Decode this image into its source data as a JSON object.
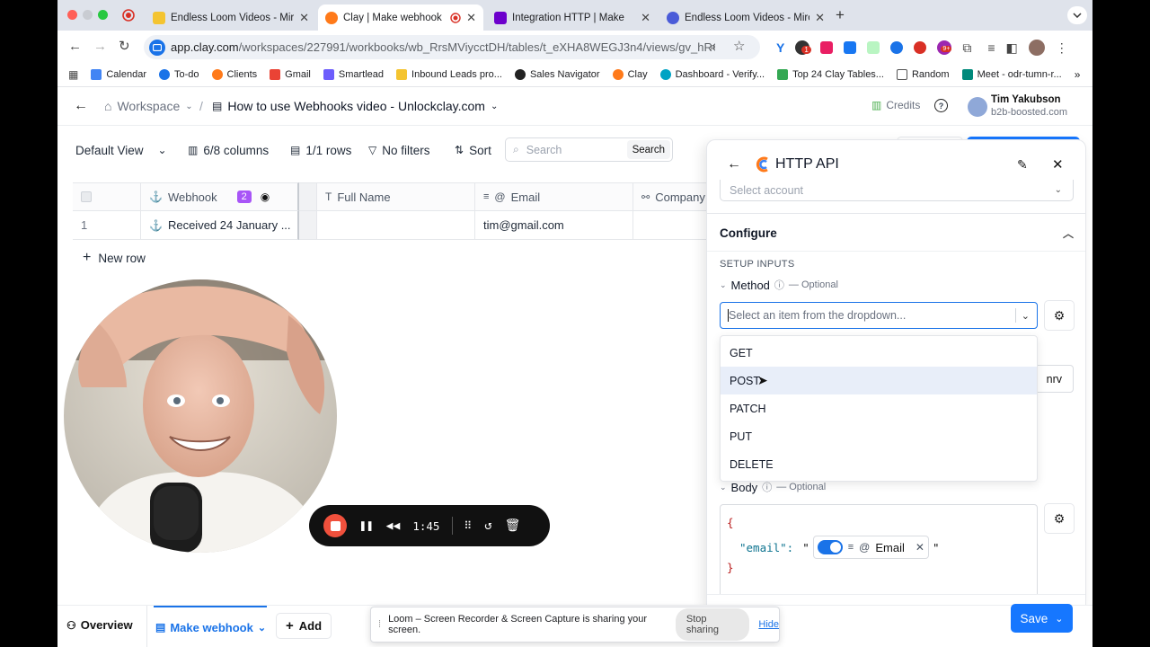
{
  "browser": {
    "tabs": [
      {
        "title": "Endless Loom Videos - Miro",
        "color": "#f4c430"
      },
      {
        "title": "Clay | Make webhook",
        "color": "#ff7a1a"
      },
      {
        "title": "Integration HTTP | Make",
        "color": "#6d00cc"
      },
      {
        "title": "Endless Loom Videos - Miro",
        "color": "#4a5bd8"
      }
    ],
    "url_host": "app.clay.com",
    "url_path": "/workspaces/227991/workbooks/wb_RrsMViycctDH/tables/t_eXHA8WEGJ3n4/views/gv_hRGJBeg...",
    "bookmarks": [
      "Calendar",
      "To-do",
      "Clients",
      "Gmail",
      "Smartlead",
      "Inbound Leads pro...",
      "Sales Navigator",
      "Clay",
      "Dashboard - Verify...",
      "Top 24 Clay Tables...",
      "Random",
      "Meet - odr-tumn-r..."
    ],
    "extension_badge": "1",
    "extension_badge2": "9+"
  },
  "app": {
    "breadcrumb_workspace": "Workspace",
    "breadcrumb_separator": "/",
    "workbook_title": "How to use Webhooks video - Unlockclay.com",
    "credits_label": "Credits",
    "user_name": "Tim Yakubson",
    "user_org": "b2b-boosted.com"
  },
  "toolbar": {
    "view": "Default View",
    "columns": "6/8 columns",
    "rows": "1/1 rows",
    "filters": "No filters",
    "sort": "Sort",
    "search_placeholder": "Search",
    "search_button": "Search"
  },
  "table": {
    "headers": [
      "Webhook",
      "Full Name",
      "Email",
      "Company"
    ],
    "webhook_badge": "2",
    "rows": [
      {
        "index": "1",
        "webhook": "Received 24 January ...",
        "full_name": "",
        "email": "tim@gmail.com",
        "company": ""
      }
    ],
    "new_row": "New row"
  },
  "recorder": {
    "time": "1:45"
  },
  "panel": {
    "title": "HTTP API",
    "select_account": "Select account",
    "configure": "Configure",
    "setup_inputs": "SETUP INPUTS",
    "method_label": "Method",
    "optional": "— Optional",
    "method_placeholder": "Select an item from the dropdown...",
    "method_options": [
      "GET",
      "POST",
      "PATCH",
      "PUT",
      "DELETE"
    ],
    "highlighted_option": "POST",
    "hidden_field_tail": "nrv",
    "body_label": "Body",
    "body_open": "{",
    "body_key": "\"email\":",
    "body_quote_open": "\"",
    "body_token": "Email",
    "body_quote_close": "\"",
    "body_close": "}",
    "save": "Save"
  },
  "bottom": {
    "overview": "Overview",
    "active_tab": "Make webhook",
    "add": "Add"
  },
  "loom_share": {
    "message": "Loom – Screen Recorder & Screen Capture is sharing your screen.",
    "stop": "Stop sharing",
    "hide": "Hide"
  },
  "colors": {
    "accent": "#1a73e8",
    "save_button": "#1677ff",
    "webhook_badge": "#a855f7",
    "record_red": "#f0503c"
  }
}
